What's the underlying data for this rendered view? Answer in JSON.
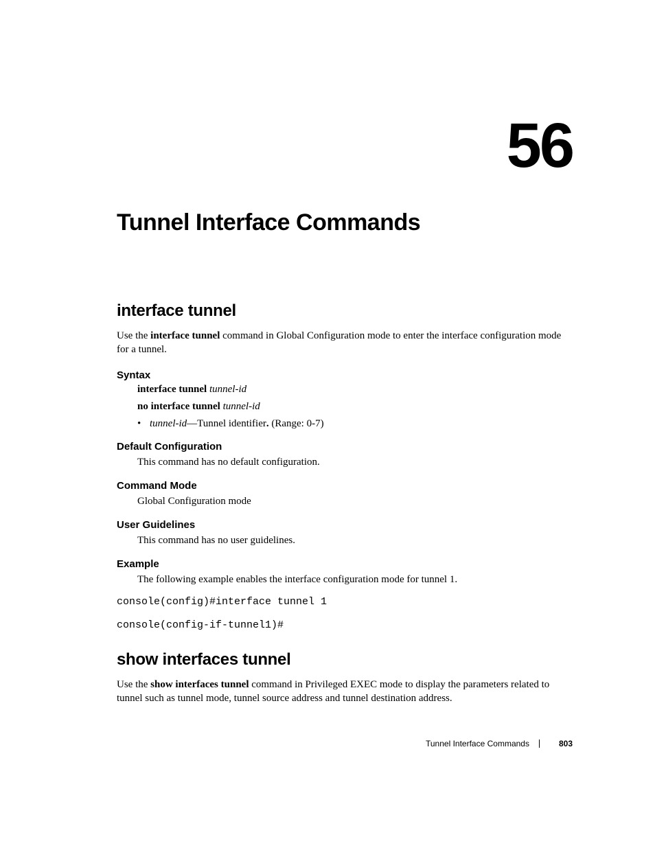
{
  "chapter": {
    "number": "56",
    "title": "Tunnel Interface Commands"
  },
  "section1": {
    "title": "interface tunnel",
    "intro_pre": "Use the ",
    "intro_bold": "interface tunnel",
    "intro_post": " command in Global Configuration mode to enter the interface configuration mode for a tunnel.",
    "syntax_heading": "Syntax",
    "syntax_line1_bold": "interface tunnel ",
    "syntax_line1_ital": "tunnel-id",
    "syntax_line2_bold": "no interface tunnel ",
    "syntax_line2_ital": "tunnel-id",
    "bullet_ital": "tunnel-id",
    "bullet_dash": "—",
    "bullet_desc": "Tunnel identifier",
    "bullet_bolddot": ".",
    "bullet_range": " (Range: 0-7)",
    "default_heading": "Default Configuration",
    "default_body": "This command has no default configuration.",
    "mode_heading": "Command Mode",
    "mode_body": "Global Configuration mode",
    "guidelines_heading": "User Guidelines",
    "guidelines_body": "This command has no user guidelines.",
    "example_heading": "Example",
    "example_body": "The following example enables the interface configuration mode for tunnel 1.",
    "code1": "console(config)#interface tunnel 1",
    "code2": "console(config-if-tunnel1)#"
  },
  "section2": {
    "title": "show interfaces tunnel",
    "intro_pre": "Use the ",
    "intro_bold": "show interfaces tunnel",
    "intro_post": " command in Privileged EXEC mode to display the parameters related to tunnel such as tunnel mode, tunnel source address and tunnel destination address."
  },
  "footer": {
    "section": "Tunnel Interface Commands",
    "page": "803"
  }
}
